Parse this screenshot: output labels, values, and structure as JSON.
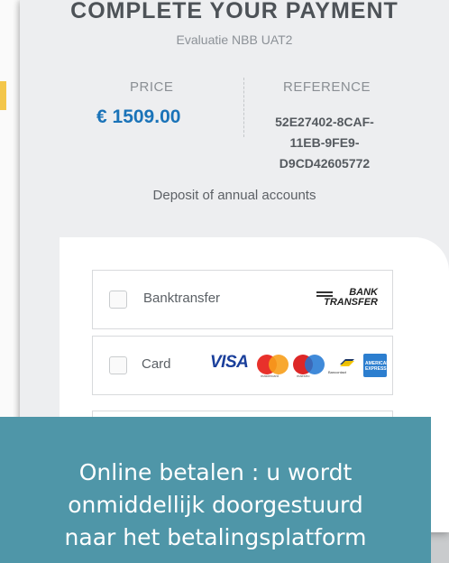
{
  "payment": {
    "title": "COMPLETE YOUR PAYMENT",
    "subtitle": "Evaluatie NBB UAT2",
    "price_label": "PRICE",
    "price_value": "€ 1509.00",
    "reference_label": "REFERENCE",
    "reference_lines": [
      "52E27402-8CAF-",
      "11EB-9FE9-",
      "D9CD42605772"
    ],
    "description": "Deposit of annual accounts"
  },
  "options": [
    {
      "label": "Banktransfer",
      "logo_text": [
        "BANK",
        "TRANSFER"
      ],
      "checked": false
    },
    {
      "label": "Card",
      "logo_text": [
        "VISA",
        "mastercard",
        "maestro",
        "Bancontact",
        "AMERICAN EXPRESS"
      ],
      "checked": false
    }
  ],
  "banner": {
    "lines": [
      "Online betalen : u wordt",
      "onmiddellijk doorgestuurd",
      "naar het betalingsplatform"
    ]
  },
  "colors": {
    "accent": "#1a73b8",
    "banner": "#4f96a8",
    "panel": "#edeef0"
  }
}
